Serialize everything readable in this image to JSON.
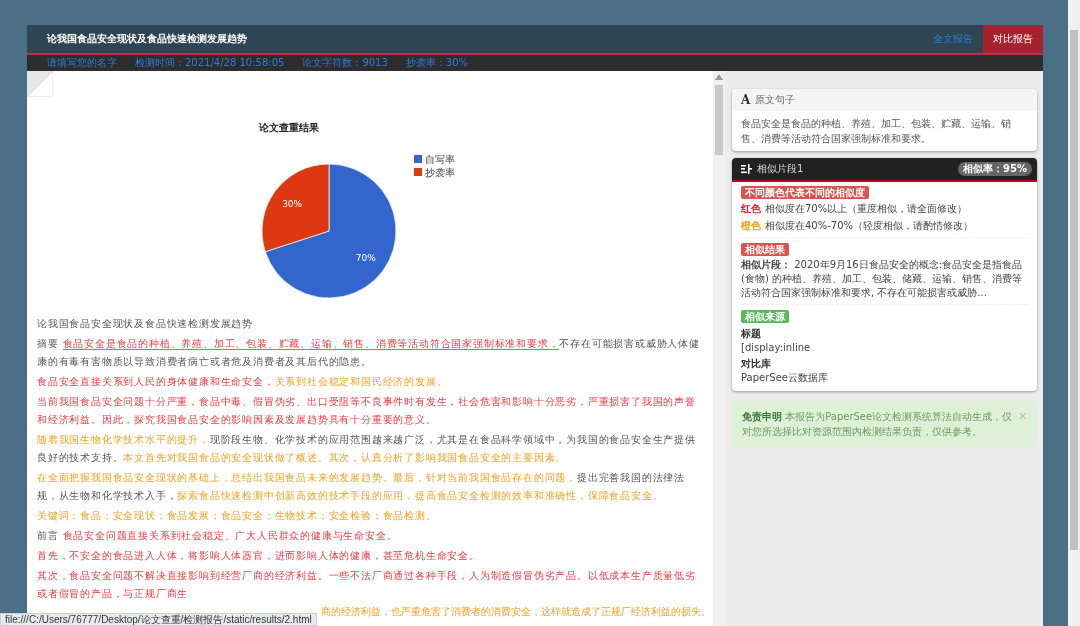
{
  "window": {
    "title": "论我国食品安全现状及食品快速检测发展趋势"
  },
  "tabs": [
    {
      "label": "全文报告",
      "selected": false
    },
    {
      "label": "对比报告",
      "selected": true
    }
  ],
  "info_bar": [
    "请填写您的名字",
    "检测时间：2021/4/28 10:58:05",
    "论文字符数：9013",
    "抄袭率：30%"
  ],
  "report": {
    "chart_data": {
      "type": "pie",
      "title": "论文查重结果",
      "categories": [
        "自写率",
        "抄袭率"
      ],
      "values": [
        70,
        30
      ],
      "colors": [
        "#3366cc",
        "#dc3912"
      ],
      "value_labels": [
        "70%",
        "30%"
      ],
      "legend": "right"
    },
    "paragraphs": [
      {
        "kind": "text",
        "segments": [
          {
            "kind": "plain",
            "text": "论我国食品安全现状及食品快速检测发展趋势"
          }
        ]
      },
      {
        "kind": "text",
        "segments": [
          {
            "kind": "plain",
            "text": "摘要 "
          },
          {
            "kind": "red-underlined",
            "text": "食品安全是食品的种植、养殖、加工、包装、贮藏、运输、销售、消费等活动符合国家强制标准和要求，"
          },
          {
            "kind": "plain",
            "text": "不存在可能损害或威胁人体健康的有毒有害物质以导致消费者病亡或者危及消费者及其后代的隐患。"
          }
        ]
      },
      {
        "kind": "text",
        "segments": [
          {
            "kind": "red",
            "text": "食品安全直接关系到人民的身体健康和生命安全，"
          },
          {
            "kind": "orange",
            "text": "关系到社会稳定和国民经济的发展。"
          }
        ]
      },
      {
        "kind": "text",
        "segments": [
          {
            "kind": "red",
            "text": "当前我国食品安全问题十分严重，食品中毒、假冒伪劣、出口受阻等不良事件时有发生，社会危害和影响十分恶劣，严重损害了我国的声誉和经济利益。因此，探究我国食品安全的影响因素及发展趋势具有十分重要的意义。"
          }
        ]
      },
      {
        "kind": "text",
        "segments": [
          {
            "kind": "orange",
            "text": "随着我国生物化学技术水平的提升，"
          },
          {
            "kind": "plain",
            "text": "现阶段生物、化学技术的应用范围越来越广泛，尤其是在食品科学领域中，为我国的食品安全生产提供良好的技术支持。"
          },
          {
            "kind": "orange",
            "text": "本文首先对我国食品的安全现状做了概述。其次，认真分析了影响我国食品安全的主要因素。"
          }
        ]
      },
      {
        "kind": "text",
        "segments": [
          {
            "kind": "orange",
            "text": "在全面把握我国食品安全现状的基础上，总结出我国食品未来的发展趋势。最后，针对当前我国食品存在的问题，"
          },
          {
            "kind": "plain",
            "text": "提出完善我国的法律法规，从生物和化学技术入手，"
          },
          {
            "kind": "orange",
            "text": "探索食品快速检测中创新高效的技术手段的应用，提高食品安全检测的效率和准确性，保障食品安全。"
          }
        ]
      },
      {
        "kind": "text",
        "segments": [
          {
            "kind": "orange",
            "text": "关键词：食品；安全现状；食品发展；食品安全；生物技术；安全检验；食品检测。"
          }
        ]
      },
      {
        "kind": "text",
        "segments": [
          {
            "kind": "plain",
            "text": "前言 "
          },
          {
            "kind": "red",
            "text": "食品安全问题直接关系到社会稳定、广大人民群众的健康与生命安全。"
          }
        ]
      },
      {
        "kind": "text",
        "segments": [
          {
            "kind": "red",
            "text": "首先，不安全的食品进入人体，将影响人体器官，进而影响人体的健康，甚至危机生命安全。"
          }
        ]
      },
      {
        "kind": "text",
        "segments": [
          {
            "kind": "red",
            "text": "其次，食品安全问题不解决直接影响到经营厂商的经济利益。一些不法厂商通过各种手段，人为制造假冒伪劣产品。以低成本生产质量低劣或者假冒的产品，与正规厂商生"
          }
        ]
      },
      {
        "kind": "continued",
        "segments": [
          {
            "kind": "orange",
            "text": "商的经济利益，也严重危害了消费者的消费安全，这样就造成了正规厂经济利益的损失。"
          }
        ]
      }
    ]
  },
  "original_card": {
    "icon": "A",
    "title": "原文句子",
    "text": "食品安全是食品的种植、养殖、加工、包装、贮藏、运输、销售、消费等活动符合国家强制标准和要求。"
  },
  "similar_card": {
    "title": "相似片段1",
    "badge": "相似率：95%",
    "legend_label": "不同颜色代表不同的相似度",
    "legend": [
      {
        "kind": "red",
        "name": "红色",
        "text": "相似度在70%以上（重度相似，请全面修改）"
      },
      {
        "kind": "orange",
        "name": "橙色",
        "text": "相似度在40%-70%（轻度相似，请酌情修改）"
      }
    ],
    "result_label": "相似结果",
    "result_text": "**相似片段：** 2020年9月16日食品安全的概念:食品安全是指食品(食物) 的种植、养殖、加工、包装、储藏、运输、销售、消费等活动符合国家强制标准和要求, 不存在可能损害或威胁...",
    "source_label": "相似来源",
    "fields": [
      {
        "name": "标题",
        "value": "[display:inline"
      },
      {
        "name": "对比库",
        "value": "PaperSee云数据库"
      }
    ]
  },
  "notice": {
    "title": "免责申明",
    "text": "本报告为PaperSee论文检测系统算法自动生成，仅对您所选择比对资源范围内检测结果负责，仅供参考。",
    "close": "×"
  },
  "status_bar": "file:///C:/Users/76777/Desktop/论文查重/检测报告/static/results/2.html"
}
